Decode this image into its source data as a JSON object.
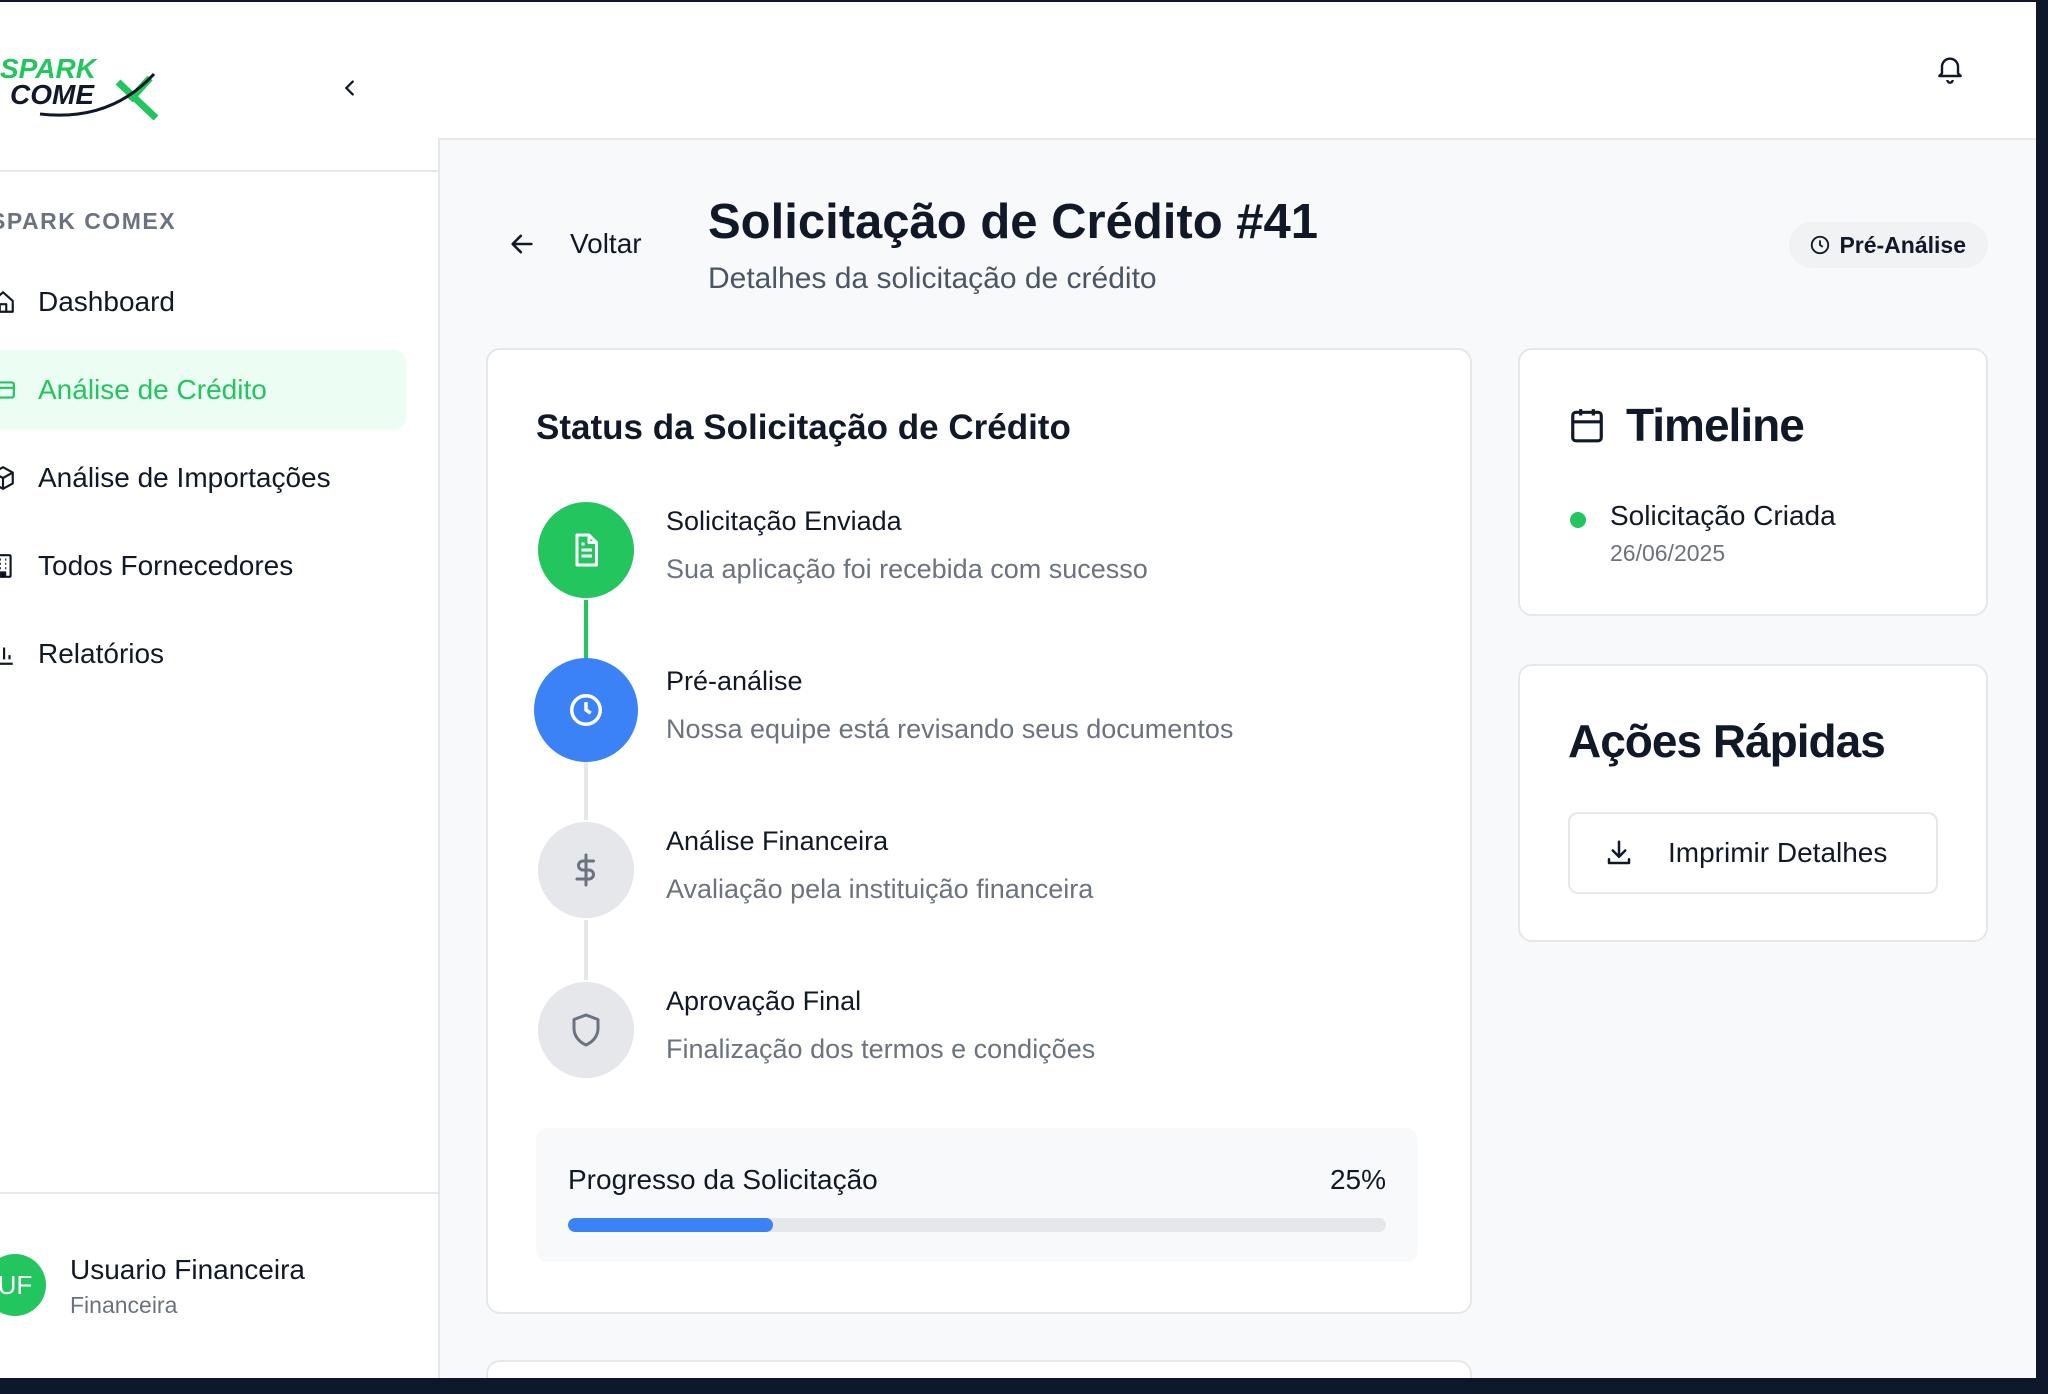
{
  "brand": {
    "logo_line1": "SPARK",
    "logo_line2": "COMEX",
    "section_label": "SPARK COMEX"
  },
  "sidebar": {
    "items": [
      {
        "label": "Dashboard",
        "icon": "home-icon",
        "active": false
      },
      {
        "label": "Análise de Crédito",
        "icon": "credit-card-icon",
        "active": true
      },
      {
        "label": "Análise de Importações",
        "icon": "package-icon",
        "active": false
      },
      {
        "label": "Todos Fornecedores",
        "icon": "building-icon",
        "active": false
      },
      {
        "label": "Relatórios",
        "icon": "bar-chart-icon",
        "active": false
      }
    ]
  },
  "user": {
    "initials": "UF",
    "name": "Usuario Financeira",
    "role": "Financeira"
  },
  "header": {
    "back_label": "Voltar",
    "title": "Solicitação de Crédito #41",
    "subtitle": "Detalhes da solicitação de crédito",
    "status_badge": "Pré-Análise"
  },
  "status_card": {
    "title": "Status da Solicitação de Crédito",
    "steps": [
      {
        "title": "Solicitação Enviada",
        "desc": "Sua aplicação foi recebida com sucesso",
        "state": "done",
        "icon": "file-icon"
      },
      {
        "title": "Pré-análise",
        "desc": "Nossa equipe está revisando seus documentos",
        "state": "current",
        "icon": "clock-icon"
      },
      {
        "title": "Análise Financeira",
        "desc": "Avaliação pela instituição financeira",
        "state": "pending",
        "icon": "dollar-icon"
      },
      {
        "title": "Aprovação Final",
        "desc": "Finalização dos termos e condições",
        "state": "pending",
        "icon": "shield-icon"
      }
    ],
    "progress_label": "Progresso da Solicitação",
    "progress_value": 25,
    "progress_text": "25%"
  },
  "timeline": {
    "title": "Timeline",
    "events": [
      {
        "label": "Solicitação Criada",
        "date": "26/06/2025"
      }
    ]
  },
  "quick_actions": {
    "title": "Ações Rápidas",
    "print_label": "Imprimir Detalhes"
  },
  "colors": {
    "green": "#22c55e",
    "blue": "#3b82f6",
    "grey": "#e5e7eb"
  }
}
